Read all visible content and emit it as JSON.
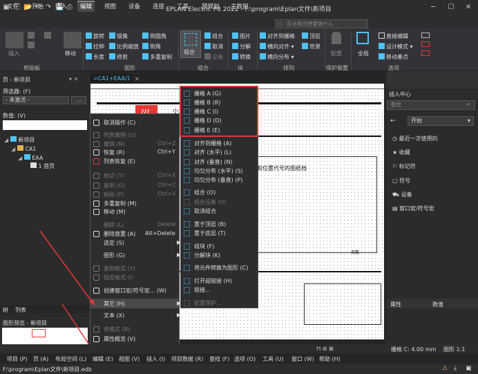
{
  "window": {
    "title": "EPLAN Electric P8 2022 - F:\\program\\Eplan文件\\新项目"
  },
  "menu_tabs": [
    "文件",
    "开始",
    "插入",
    "编辑",
    "视图",
    "设备",
    "连接",
    "工具",
    "预规划",
    "主数据"
  ],
  "search": {
    "placeholder": "告诉我您想要做什么"
  },
  "ribbon": {
    "paste": "插入",
    "move": "移动",
    "col1": [
      "旋转",
      "拉伸",
      "长度"
    ],
    "col2": [
      "镜像",
      "比例缩放",
      "修剪"
    ],
    "col3": [
      "倒圆角",
      "倒角",
      "多重复制"
    ],
    "group_btn": "组合",
    "col4": [
      "组合",
      "取消",
      "设备"
    ],
    "col5": [
      "图片",
      "分解",
      "转换"
    ],
    "col6": [
      "对齐到栅格",
      "横向对齐",
      "横向分布"
    ],
    "col6b": [
      "顶层",
      "背景"
    ],
    "protect": "配置",
    "global": "全局",
    "col7": [
      "直接编辑",
      "设计模式",
      "移动基点"
    ],
    "groups": [
      "剪贴板",
      "图形",
      "组合",
      "块",
      "排列",
      "保护装置",
      "选项"
    ]
  },
  "left": {
    "title": "页 - 新项目",
    "filter_label": "筛选器: (F)",
    "filter_value": "- 未激活 -",
    "value_label": "数值: (V)",
    "tree": [
      "新项目",
      "CA1",
      "EAA",
      "1 首页"
    ],
    "tabs": [
      "树",
      "列表"
    ],
    "preview_title": "图形预览 - 新项目"
  },
  "doc_tab": "=CA1+EAA/1",
  "page_text": {
    "title": "小",
    "table_header": "高层代号和位置代号的图纸档",
    "cell": "页数"
  },
  "context_menu": [
    {
      "label": "取消操作 (C)",
      "shortcut": "",
      "dis": false,
      "icon": "cancel-icon",
      "ic": "#ddd"
    },
    {
      "label": "列表撤销 (U)",
      "shortcut": "",
      "dis": true,
      "icon": "undo-list-icon",
      "ic": "#777"
    },
    {
      "label": "撤销 (N)",
      "shortcut": "Ctrl+Z",
      "dis": true,
      "icon": "undo-icon",
      "ic": "#777"
    },
    {
      "label": "恢复 (R)",
      "shortcut": "Ctrl+Y",
      "dis": false,
      "icon": "redo-icon",
      "ic": "#ddd"
    },
    {
      "label": "列表恢复 (E)",
      "shortcut": "",
      "dis": false,
      "icon": "redo-list-icon",
      "ic": "#e53935"
    },
    {
      "label": "剪切 (T)",
      "shortcut": "Ctrl+X",
      "dis": true,
      "icon": "cut-icon",
      "ic": "#777"
    },
    {
      "label": "复制 (O)",
      "shortcut": "Ctrl+C",
      "dis": true,
      "icon": "copy-icon",
      "ic": "#777"
    },
    {
      "label": "粘贴 (P)",
      "shortcut": "Ctrl+V",
      "dis": true,
      "icon": "paste-icon",
      "ic": "#777"
    },
    {
      "label": "多重复制 (M)",
      "shortcut": "",
      "dis": false,
      "icon": "multi-copy-icon",
      "ic": "#ddd"
    },
    {
      "label": "移动 (M)",
      "shortcut": "",
      "dis": false,
      "icon": "move-icon",
      "ic": "#ddd"
    },
    {
      "label": "删除 (L)",
      "shortcut": "Delete",
      "dis": true,
      "icon": "",
      "ic": ""
    },
    {
      "label": "删除放置 (A)",
      "shortcut": "Alt+Delete",
      "dis": false,
      "icon": "delete-placement-icon",
      "ic": "#ddd"
    },
    {
      "label": "选定 (S)",
      "shortcut": "",
      "dis": false,
      "icon": "",
      "ic": "",
      "arrow": true
    },
    {
      "label": "图形 (G)",
      "shortcut": "",
      "dis": false,
      "icon": "",
      "ic": "",
      "arrow": true
    },
    {
      "label": "复制格式 (Y)",
      "shortcut": "",
      "dis": true,
      "icon": "copy-format-icon",
      "ic": "#777"
    },
    {
      "label": "指定格式 (I)",
      "shortcut": "",
      "dis": true,
      "icon": "assign-format-icon",
      "ic": "#777"
    },
    {
      "label": "创建窗口宏/符号宏... (W)",
      "shortcut": "",
      "dis": false,
      "icon": "macro-icon",
      "ic": "#ddd"
    },
    {
      "label": "其它 (H)",
      "shortcut": "",
      "dis": false,
      "icon": "",
      "ic": "",
      "arrow": true,
      "active": true
    },
    {
      "label": "文本 (X)",
      "shortcut": "",
      "dis": false,
      "icon": "",
      "ic": "",
      "arrow": true
    },
    {
      "label": "表格式 (B)",
      "shortcut": "",
      "dis": true,
      "icon": "table-format-icon",
      "ic": "#777"
    },
    {
      "label": "属性概览 (V)",
      "shortcut": "",
      "dis": false,
      "icon": "properties-icon",
      "ic": "#ddd"
    },
    {
      "label": "属性...",
      "shortcut": "Ctrl+D",
      "dis": true,
      "icon": "",
      "ic": ""
    }
  ],
  "submenu": [
    {
      "label": "栅格 A (G)",
      "dis": false,
      "icon": "grid-icon"
    },
    {
      "label": "栅格 B (R)",
      "dis": false,
      "icon": "grid-icon"
    },
    {
      "label": "栅格 C (I)",
      "dis": false,
      "icon": "grid-icon"
    },
    {
      "label": "栅格 D (D)",
      "dis": false,
      "icon": "grid-icon"
    },
    {
      "label": "栅格 E (E)",
      "dis": false,
      "icon": "grid-icon"
    },
    {
      "label": "对齐到栅格 (A)",
      "dis": false,
      "icon": "align-grid-icon"
    },
    {
      "label": "对齐 (水平) (L)",
      "dis": false,
      "icon": "align-horizontal-icon"
    },
    {
      "label": "对齐 (垂直) (N)",
      "dis": false,
      "icon": "align-vertical-icon"
    },
    {
      "label": "均匀分布 (水平) (S)",
      "dis": false,
      "icon": "distribute-horizontal-icon"
    },
    {
      "label": "均匀分布 (垂直) (P)",
      "dis": false,
      "icon": "distribute-vertical-icon"
    },
    {
      "label": "组合 (O)",
      "dis": false,
      "icon": "group-icon"
    },
    {
      "label": "组合设备 (U)",
      "dis": true,
      "icon": "group-device-icon"
    },
    {
      "label": "取消组合",
      "dis": false,
      "icon": "ungroup-icon"
    },
    {
      "label": "置于顶层 (B)",
      "dis": false,
      "icon": "bring-front-icon"
    },
    {
      "label": "置于底层 (T)",
      "dis": false,
      "icon": "send-back-icon"
    },
    {
      "label": "组块 (F)",
      "dis": false,
      "icon": "block-icon"
    },
    {
      "label": "分解块 (K)",
      "dis": false,
      "icon": "explode-block-icon"
    },
    {
      "label": "将元件转换为图形 (C)",
      "dis": false,
      "icon": "convert-graphic-icon"
    },
    {
      "label": "打开超链接 (H)",
      "dis": false,
      "icon": "hyperlink-open-icon"
    },
    {
      "label": "链接...",
      "dis": false,
      "icon": "link-icon"
    },
    {
      "label": "配置保护...",
      "dis": true,
      "icon": "protect-icon"
    }
  ],
  "right": {
    "title": "插入中心",
    "search_placeholder": "查找",
    "nav": "开始",
    "items": [
      "最近一次使用的",
      "收藏",
      "标记符",
      "符号",
      "设备",
      "窗口宏/符号宏"
    ],
    "props": [
      "属性",
      "数值"
    ]
  },
  "status": {
    "grid": "栅格 C: 4.00 mm",
    "graphic": "图形 1:1"
  },
  "bottom_menu": [
    "项目 (P)",
    "页 (A)",
    "布局空间 (L)",
    "编辑 (E)",
    "视图 (V)",
    "插入 (I)",
    "项目数据 (R)",
    "查找 (F)",
    "选项 (O)",
    "工具 (U)",
    "窗口 (W)",
    "帮助 (H)"
  ],
  "path": "F:\\program\\Eplan文件\\新项目.edb"
}
